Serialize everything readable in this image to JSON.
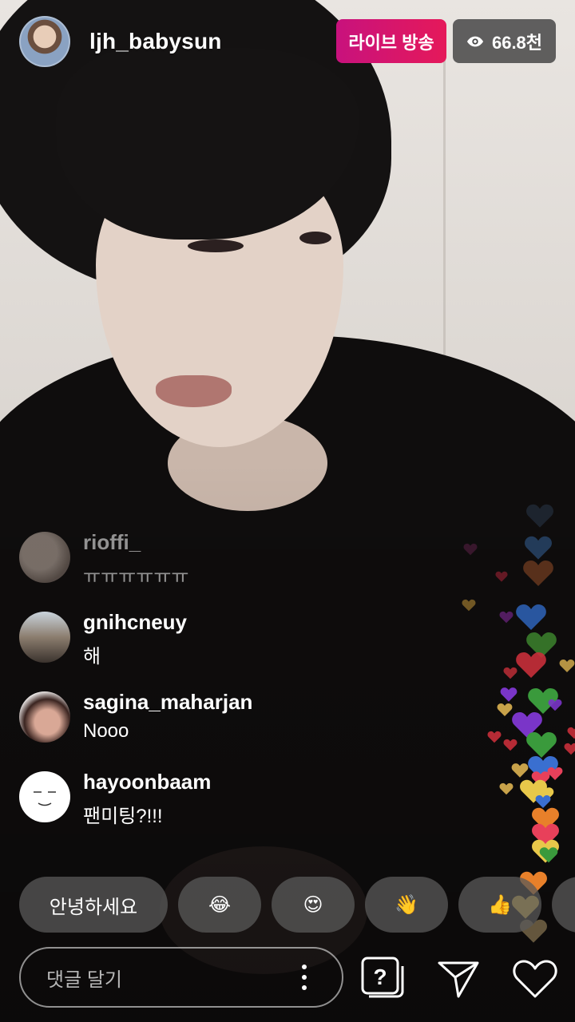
{
  "header": {
    "host_name": "ljh_babysun",
    "live_label": "라이브 방송",
    "viewer_count": "66.8천"
  },
  "comments": [
    {
      "user": "rioffi_",
      "text": "ㅠㅠㅠㅠㅠㅠ"
    },
    {
      "user": "gnihcneuy",
      "text": "해"
    },
    {
      "user": "sagina_maharjan",
      "text": "Nooo"
    },
    {
      "user": "hayoonbaam",
      "text": "팬미팅?!!!"
    }
  ],
  "quick_reactions": [
    {
      "label": "안녕하세요"
    },
    {
      "label": "😂"
    },
    {
      "label": "😍"
    },
    {
      "label": "👋"
    },
    {
      "label": "👍"
    }
  ],
  "input": {
    "placeholder": "댓글 달기"
  },
  "icons": [
    "eye-icon",
    "more-icon",
    "question-icon",
    "send-icon",
    "heart-icon"
  ],
  "colors": {
    "live_gradient_start": "#c8127d",
    "live_gradient_end": "#e5195a",
    "viewer_badge": "#464646"
  }
}
